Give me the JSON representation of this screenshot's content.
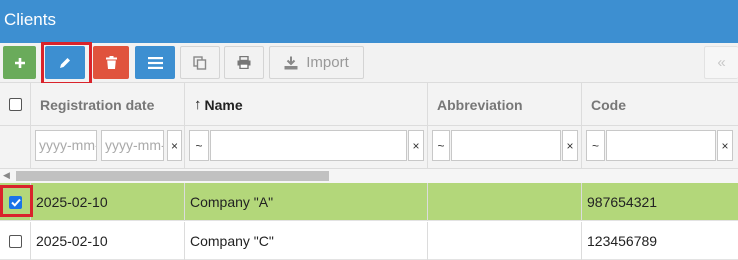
{
  "window": {
    "title": "Clients"
  },
  "toolbar": {
    "add": {
      "icon": "plus-icon",
      "color": "#6aab5b"
    },
    "edit": {
      "icon": "pencil-icon",
      "color": "#3d8fd1"
    },
    "delete": {
      "icon": "trash-icon",
      "color": "#e0533d"
    },
    "list": {
      "icon": "list-icon",
      "color": "#3d8fd1"
    },
    "copy": {
      "icon": "copy-icon"
    },
    "print": {
      "icon": "print-icon"
    },
    "import": {
      "icon": "download-icon",
      "label": "Import"
    },
    "collapse": {
      "label": "«"
    }
  },
  "grid": {
    "columns": [
      {
        "key": "select",
        "label": ""
      },
      {
        "key": "registration_date",
        "label": "Registration date"
      },
      {
        "key": "name",
        "label": "Name",
        "sorted": "ascending"
      },
      {
        "key": "abbreviation",
        "label": "Abbreviation"
      },
      {
        "key": "code",
        "label": "Code"
      }
    ],
    "filters": {
      "date_from_placeholder": "yyyy-mm-dd",
      "date_to_placeholder": "yyyy-mm-dd",
      "clear": "×",
      "operator": "~"
    },
    "rows": [
      {
        "selected": true,
        "registration_date": "2025-02-10",
        "name": "Company \"A\"",
        "abbreviation": "",
        "code": "987654321"
      },
      {
        "selected": false,
        "registration_date": "2025-02-10",
        "name": "Company \"C\"",
        "abbreviation": "",
        "code": "123456789"
      }
    ]
  },
  "colors": {
    "header_blue": "#3d8fd1",
    "selected_row": "#b3d77a",
    "highlight_red": "#d9232b"
  }
}
